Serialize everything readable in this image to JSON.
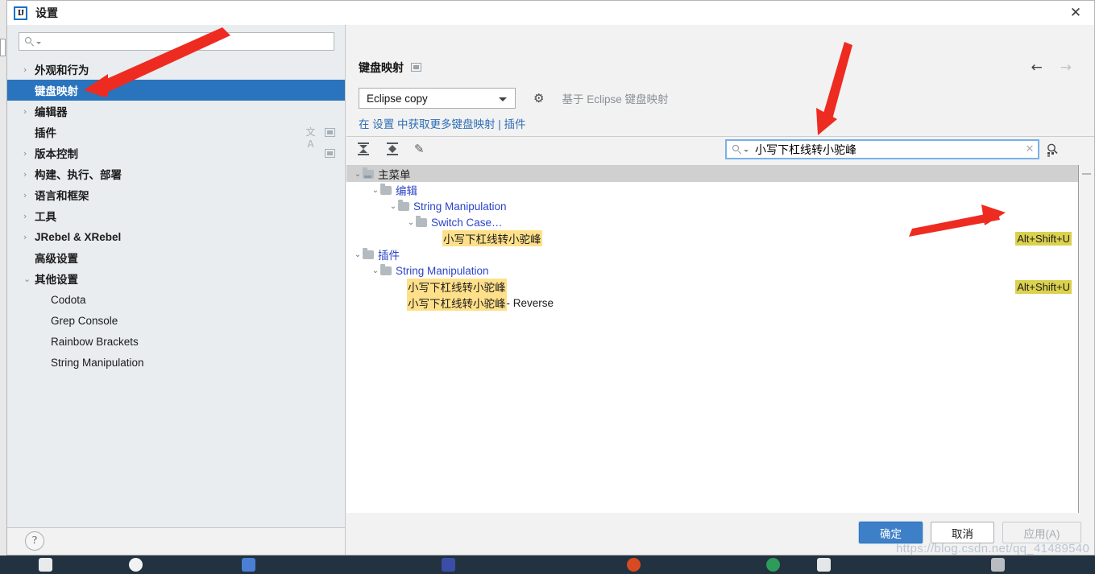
{
  "window": {
    "title": "设置",
    "logo_text": "IJ",
    "close_label": "✕"
  },
  "sidebar": {
    "search": {
      "value": "",
      "placeholder": "",
      "icon": "search-icon"
    },
    "items": [
      {
        "label": "外观和行为",
        "chevron": "›",
        "bold": true,
        "indent": 0,
        "selected": false,
        "icons": []
      },
      {
        "label": "键盘映射",
        "chevron": "",
        "bold": true,
        "indent": 0,
        "selected": true,
        "icons": []
      },
      {
        "label": "编辑器",
        "chevron": "›",
        "bold": true,
        "indent": 0,
        "selected": false,
        "icons": []
      },
      {
        "label": "插件",
        "chevron": "",
        "bold": true,
        "indent": 0,
        "selected": false,
        "icons": [
          "translate-icon",
          "window-icon"
        ]
      },
      {
        "label": "版本控制",
        "chevron": "›",
        "bold": true,
        "indent": 0,
        "selected": false,
        "icons": [
          "window-icon"
        ]
      },
      {
        "label": "构建、执行、部署",
        "chevron": "›",
        "bold": true,
        "indent": 0,
        "selected": false,
        "icons": []
      },
      {
        "label": "语言和框架",
        "chevron": "›",
        "bold": true,
        "indent": 0,
        "selected": false,
        "icons": []
      },
      {
        "label": "工具",
        "chevron": "›",
        "bold": true,
        "indent": 0,
        "selected": false,
        "icons": []
      },
      {
        "label": "JRebel & XRebel",
        "chevron": "›",
        "bold": true,
        "indent": 0,
        "selected": false,
        "icons": []
      },
      {
        "label": "高级设置",
        "chevron": "",
        "bold": true,
        "indent": 0,
        "selected": false,
        "icons": []
      },
      {
        "label": "其他设置",
        "chevron": "⌄",
        "bold": true,
        "indent": 0,
        "selected": false,
        "icons": []
      },
      {
        "label": "Codota",
        "chevron": "",
        "bold": false,
        "indent": 1,
        "selected": false,
        "icons": []
      },
      {
        "label": "Grep Console",
        "chevron": "",
        "bold": false,
        "indent": 1,
        "selected": false,
        "icons": []
      },
      {
        "label": "Rainbow Brackets",
        "chevron": "",
        "bold": false,
        "indent": 1,
        "selected": false,
        "icons": []
      },
      {
        "label": "String Manipulation",
        "chevron": "",
        "bold": false,
        "indent": 1,
        "selected": false,
        "icons": []
      }
    ],
    "help_button": "?"
  },
  "pane": {
    "title": "键盘映射",
    "nav_back": "←",
    "nav_forward": "→",
    "keymap_value": "Eclipse copy",
    "gear_icon": "gear-icon",
    "based_on": "基于 Eclipse 键盘映射",
    "link_line": "在 设置 中获取更多键盘映射 | 插件"
  },
  "toolbar": {
    "expand_all": "expand-all-icon",
    "collapse_all": "collapse-all-icon",
    "edit": "edit-pencil-icon",
    "find_value": "小写下杠线转小驼峰",
    "find_placeholder": "",
    "clear_icon": "✕",
    "find_by_shortcut_icon": "find-by-shortcut-icon"
  },
  "tree": {
    "rows": [
      {
        "indent": 0,
        "chevron": "⌄",
        "folder": "menu",
        "text": "主菜单",
        "color": "dark",
        "highlight": "",
        "suffix": "",
        "shortcut": "",
        "selected": true
      },
      {
        "indent": 1,
        "chevron": "⌄",
        "folder": "plain",
        "text": "编辑",
        "color": "blue",
        "highlight": "",
        "suffix": "",
        "shortcut": "",
        "selected": false
      },
      {
        "indent": 2,
        "chevron": "⌄",
        "folder": "plain",
        "text": "String Manipulation",
        "color": "blue",
        "highlight": "",
        "suffix": "",
        "shortcut": "",
        "selected": false
      },
      {
        "indent": 3,
        "chevron": "⌄",
        "folder": "plain",
        "text": "Switch Case…",
        "color": "blue",
        "highlight": "",
        "suffix": "",
        "shortcut": "",
        "selected": false
      },
      {
        "indent": 4,
        "chevron": "",
        "folder": "none",
        "text": "",
        "color": "dark",
        "highlight": "小写下杠线转小驼峰",
        "suffix": "",
        "shortcut": "Alt+Shift+U",
        "selected": false
      },
      {
        "indent": 0,
        "chevron": "⌄",
        "folder": "plain",
        "text": "插件",
        "color": "blue",
        "highlight": "",
        "suffix": "",
        "shortcut": "",
        "selected": false
      },
      {
        "indent": 1,
        "chevron": "⌄",
        "folder": "plain",
        "text": "String Manipulation",
        "color": "blue",
        "highlight": "",
        "suffix": "",
        "shortcut": "",
        "selected": false
      },
      {
        "indent": 2,
        "chevron": "",
        "folder": "none",
        "text": "",
        "color": "dark",
        "highlight": "小写下杠线转小驼峰",
        "suffix": "",
        "shortcut": "Alt+Shift+U",
        "selected": false
      },
      {
        "indent": 2,
        "chevron": "",
        "folder": "none",
        "text": "",
        "color": "dark",
        "highlight": "小写下杠线转小驼峰",
        "suffix": " - Reverse",
        "shortcut": "",
        "selected": false
      }
    ]
  },
  "buttons": {
    "ok": "确定",
    "cancel": "取消",
    "apply": "应用(A)"
  },
  "watermark": "https://blog.csdn.net/qq_41489540",
  "colors": {
    "selection_blue": "#2a74bd",
    "link_blue": "#2e6fb5",
    "tree_blue": "#2b44c7",
    "highlight_yellow": "#ffe08a",
    "shortcut_yellow": "#dbd14e",
    "ok_button": "#3d80c8",
    "annotation_red": "#ee2b21"
  }
}
